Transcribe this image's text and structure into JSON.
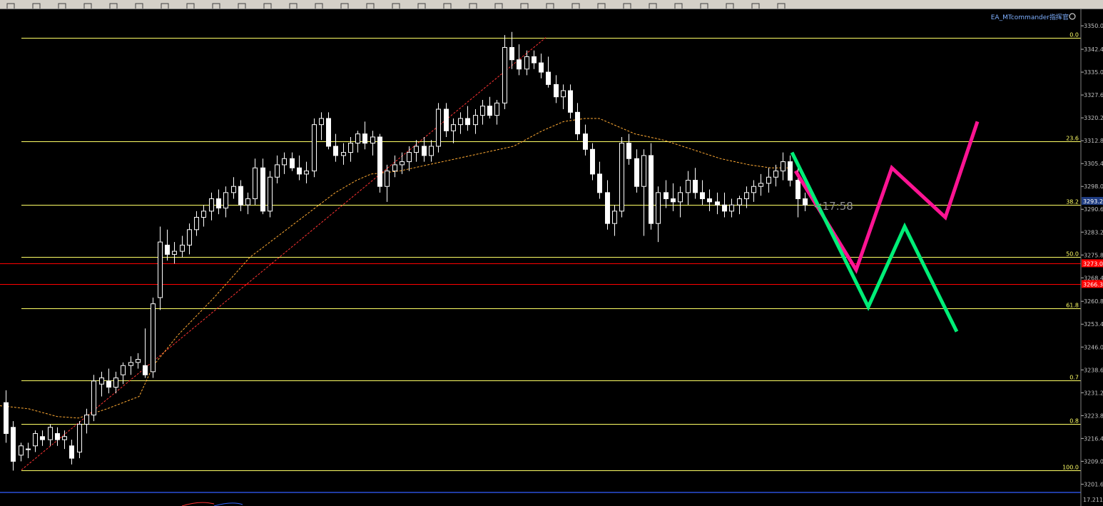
{
  "window": {
    "expert_label": "EA_MTcommander指挥官"
  },
  "toolbar": {
    "icons": [
      "new-chart-icon",
      "open-icon",
      "profiles-icon",
      "navigator-icon",
      "zoom-in-icon",
      "zoom-out-icon",
      "tile-icon",
      "autoscroll-icon",
      "shift-icon",
      "new-order-icon",
      "expert-advisors-icon",
      "history-icon",
      "period-m1-icon",
      "period-m5-icon",
      "period-m15-icon",
      "period-m30-icon",
      "period-h1-icon",
      "period-h4-icon",
      "period-d1-icon",
      "period-w1-icon",
      "period-mn-icon",
      "cursor-icon",
      "crosshair-icon",
      "vertical-line-icon",
      "horizontal-line-icon",
      "trendline-icon",
      "equidistant-channel-icon",
      "fibonacci-icon",
      "text-icon",
      "text-label-icon",
      "arrows-icon"
    ]
  },
  "colors": {
    "background": "#000000",
    "candle": "#ffffff",
    "fib_line": "#ffff66",
    "red_level": "#ff0000",
    "ma": "#ffaa33",
    "trend": "#ff3333",
    "forecast_pink": "#ff1493",
    "forecast_green": "#00ee77",
    "axis_text": "#c0c0c0",
    "price_box_blue": "#1e3c82",
    "price_box_red": "#ff0000"
  },
  "chart_data": {
    "type": "candlestick",
    "ylim": [
      3199.5,
      3352.0
    ],
    "y_ticks": [
      "3350.0",
      "3342.4",
      "3335.0",
      "3327.6",
      "3320.2",
      "3312.8",
      "3305.4",
      "3298.0",
      "3290.6",
      "3283.2",
      "3275.8",
      "3268.4",
      "3260.8",
      "3253.4",
      "3246.0",
      "3238.6",
      "3231.2",
      "3223.8",
      "3216.4",
      "3209.0",
      "3201.6"
    ],
    "fib_levels": [
      {
        "label": "0.0",
        "price": 3346.2
      },
      {
        "label": "23.6",
        "price": 3312.5
      },
      {
        "label": "38.2",
        "price": 3292.0
      },
      {
        "label": "50.0",
        "price": 3275.2
      },
      {
        "label": "61.8",
        "price": 3258.6
      },
      {
        "label": "0.7",
        "price": 3235.2
      },
      {
        "label": "0.8",
        "price": 3221.0
      },
      {
        "label": "100.0",
        "price": 3206.2
      }
    ],
    "red_levels": [
      {
        "label": "3273.0",
        "price": 3273.0
      },
      {
        "label": "3266.3",
        "price": 3266.3
      }
    ],
    "current_price": {
      "label": "3293.2",
      "price": 3293.2
    },
    "countdown": "<17:58",
    "bottom_value": "17.211",
    "candles": [
      [
        3228,
        3232,
        3215,
        3218
      ],
      [
        3220,
        3222,
        3206,
        3209
      ],
      [
        3211,
        3215,
        3209,
        3214
      ],
      [
        3213,
        3215,
        3210,
        3213
      ],
      [
        3214,
        3219,
        3212,
        3218
      ],
      [
        3217,
        3219,
        3214,
        3216
      ],
      [
        3216,
        3221,
        3214,
        3220
      ],
      [
        3218,
        3220,
        3214,
        3216
      ],
      [
        3216,
        3219,
        3213,
        3217
      ],
      [
        3214,
        3216,
        3208,
        3210
      ],
      [
        3212,
        3222,
        3210,
        3221
      ],
      [
        3221,
        3226,
        3218,
        3224
      ],
      [
        3224,
        3237,
        3222,
        3235
      ],
      [
        3234,
        3238,
        3230,
        3236
      ],
      [
        3235,
        3239,
        3231,
        3233
      ],
      [
        3233,
        3238,
        3231,
        3236
      ],
      [
        3237,
        3241,
        3234,
        3240
      ],
      [
        3240,
        3243,
        3237,
        3241
      ],
      [
        3241,
        3244,
        3239,
        3242
      ],
      [
        3240,
        3252,
        3236,
        3237
      ],
      [
        3238,
        3262,
        3236,
        3260
      ],
      [
        3262,
        3285,
        3258,
        3280
      ],
      [
        3279,
        3284,
        3274,
        3276
      ],
      [
        3276,
        3280,
        3273,
        3277
      ],
      [
        3277,
        3282,
        3275,
        3279
      ],
      [
        3279,
        3286,
        3276,
        3284
      ],
      [
        3284,
        3290,
        3282,
        3288
      ],
      [
        3288,
        3292,
        3285,
        3290
      ],
      [
        3290,
        3296,
        3287,
        3294
      ],
      [
        3294,
        3297,
        3289,
        3291
      ],
      [
        3291,
        3298,
        3288,
        3296
      ],
      [
        3296,
        3301,
        3294,
        3298
      ],
      [
        3298,
        3300,
        3290,
        3292
      ],
      [
        3292,
        3296,
        3289,
        3294
      ],
      [
        3294,
        3307,
        3292,
        3304
      ],
      [
        3304,
        3307,
        3289,
        3290
      ],
      [
        3290,
        3303,
        3288,
        3301
      ],
      [
        3301,
        3308,
        3299,
        3305
      ],
      [
        3305,
        3309,
        3302,
        3307
      ],
      [
        3307,
        3309,
        3303,
        3304
      ],
      [
        3304,
        3308,
        3300,
        3302
      ],
      [
        3302,
        3306,
        3299,
        3303
      ],
      [
        3303,
        3320,
        3301,
        3318
      ],
      [
        3318,
        3322,
        3313,
        3320
      ],
      [
        3320,
        3322,
        3310,
        3311
      ],
      [
        3311,
        3315,
        3306,
        3308
      ],
      [
        3308,
        3312,
        3305,
        3309
      ],
      [
        3309,
        3314,
        3306,
        3312
      ],
      [
        3312,
        3316,
        3309,
        3315
      ],
      [
        3315,
        3319,
        3310,
        3312
      ],
      [
        3312,
        3316,
        3308,
        3314
      ],
      [
        3314,
        3315,
        3296,
        3298
      ],
      [
        3298,
        3305,
        3293,
        3303
      ],
      [
        3303,
        3308,
        3301,
        3305
      ],
      [
        3305,
        3309,
        3302,
        3306
      ],
      [
        3306,
        3311,
        3303,
        3309
      ],
      [
        3309,
        3313,
        3306,
        3311
      ],
      [
        3311,
        3314,
        3306,
        3308
      ],
      [
        3308,
        3313,
        3306,
        3311
      ],
      [
        3311,
        3325,
        3309,
        3323
      ],
      [
        3323,
        3325,
        3314,
        3316
      ],
      [
        3316,
        3320,
        3312,
        3318
      ],
      [
        3318,
        3322,
        3315,
        3320
      ],
      [
        3320,
        3324,
        3316,
        3318
      ],
      [
        3318,
        3323,
        3315,
        3321
      ],
      [
        3321,
        3326,
        3318,
        3324
      ],
      [
        3324,
        3327,
        3320,
        3321
      ],
      [
        3321,
        3326,
        3318,
        3325
      ],
      [
        3325,
        3347,
        3323,
        3343
      ],
      [
        3343,
        3348,
        3336,
        3339
      ],
      [
        3339,
        3344,
        3334,
        3336
      ],
      [
        3336,
        3342,
        3334,
        3340
      ],
      [
        3340,
        3342,
        3336,
        3338
      ],
      [
        3338,
        3341,
        3333,
        3335
      ],
      [
        3335,
        3340,
        3330,
        3331
      ],
      [
        3331,
        3334,
        3325,
        3327
      ],
      [
        3327,
        3331,
        3323,
        3329
      ],
      [
        3329,
        3331,
        3320,
        3322
      ],
      [
        3322,
        3325,
        3313,
        3315
      ],
      [
        3315,
        3318,
        3308,
        3310
      ],
      [
        3310,
        3312,
        3300,
        3302
      ],
      [
        3302,
        3306,
        3294,
        3296
      ],
      [
        3296,
        3300,
        3284,
        3286
      ],
      [
        3286,
        3292,
        3282,
        3290
      ],
      [
        3290,
        3314,
        3288,
        3312
      ],
      [
        3312,
        3315,
        3305,
        3307
      ],
      [
        3307,
        3310,
        3296,
        3298
      ],
      [
        3298,
        3310,
        3282,
        3308
      ],
      [
        3308,
        3312,
        3284,
        3286
      ],
      [
        3286,
        3298,
        3280,
        3296
      ],
      [
        3296,
        3300,
        3291,
        3294
      ],
      [
        3294,
        3299,
        3290,
        3293
      ],
      [
        3293,
        3298,
        3288,
        3296
      ],
      [
        3296,
        3303,
        3292,
        3300
      ],
      [
        3300,
        3304,
        3294,
        3296
      ],
      [
        3296,
        3300,
        3292,
        3294
      ],
      [
        3294,
        3297,
        3290,
        3293
      ],
      [
        3293,
        3296,
        3289,
        3292
      ],
      [
        3292,
        3296,
        3288,
        3290
      ],
      [
        3290,
        3294,
        3288,
        3292
      ],
      [
        3292,
        3295,
        3289,
        3294
      ],
      [
        3294,
        3298,
        3291,
        3296
      ],
      [
        3296,
        3300,
        3293,
        3298
      ],
      [
        3298,
        3302,
        3295,
        3299
      ],
      [
        3299,
        3304,
        3296,
        3301
      ],
      [
        3301,
        3305,
        3298,
        3303
      ],
      [
        3303,
        3309,
        3300,
        3306
      ],
      [
        3306,
        3308,
        3298,
        3300
      ],
      [
        3300,
        3305,
        3288,
        3294
      ],
      [
        3294,
        3296,
        3290,
        3292
      ]
    ],
    "ma": [
      [
        0,
        3227
      ],
      [
        40,
        3226
      ],
      [
        80,
        3223.5
      ],
      [
        110,
        3223
      ],
      [
        150,
        3226
      ],
      [
        195,
        3230
      ],
      [
        215,
        3240
      ],
      [
        250,
        3250
      ],
      [
        300,
        3262
      ],
      [
        350,
        3275
      ],
      [
        390,
        3282
      ],
      [
        430,
        3289
      ],
      [
        470,
        3296
      ],
      [
        500,
        3300
      ],
      [
        520,
        3302
      ],
      [
        560,
        3303
      ],
      [
        600,
        3305
      ],
      [
        640,
        3307
      ],
      [
        680,
        3309
      ],
      [
        720,
        3311
      ],
      [
        760,
        3316
      ],
      [
        790,
        3319
      ],
      [
        820,
        3320
      ],
      [
        840,
        3320
      ],
      [
        860,
        3318
      ],
      [
        890,
        3315
      ],
      [
        930,
        3313
      ],
      [
        970,
        3310
      ],
      [
        1010,
        3307
      ],
      [
        1050,
        3305
      ],
      [
        1080,
        3304
      ],
      [
        1110,
        3304
      ]
    ],
    "trendline": [
      [
        30,
        3206.2
      ],
      [
        765,
        3346.2
      ]
    ],
    "forecast_pink": [
      [
        1115,
        3303
      ],
      [
        1200,
        3271
      ],
      [
        1250,
        3304
      ],
      [
        1325,
        3288
      ],
      [
        1370,
        3319
      ]
    ],
    "forecast_green": [
      [
        1110,
        3309
      ],
      [
        1217,
        3259
      ],
      [
        1268,
        3285
      ],
      [
        1341,
        3251
      ]
    ]
  }
}
